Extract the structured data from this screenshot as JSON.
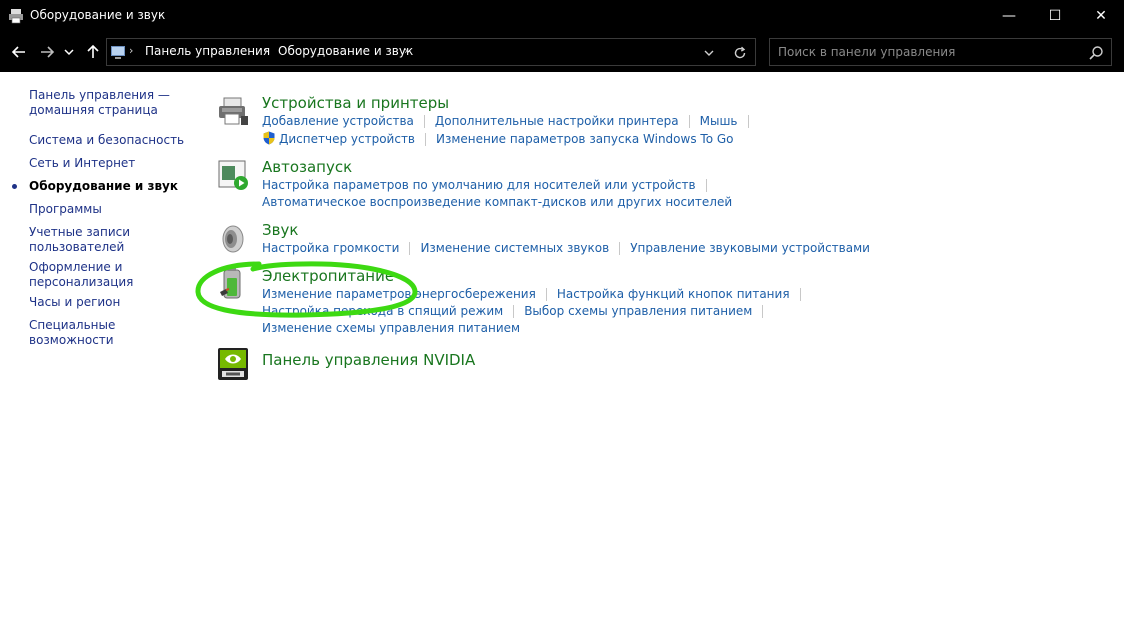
{
  "window": {
    "title": "Оборудование и звук",
    "controls": {
      "minimize": "—",
      "maximize": "☐",
      "close": "✕"
    }
  },
  "nav": {
    "back_icon": "arrow-left-icon",
    "forward_icon": "arrow-right-icon",
    "up_icon": "arrow-up-icon",
    "breadcrumbs": [
      "Панель управления",
      "Оборудование и звук"
    ],
    "breadcrumb_separator": "›",
    "search": {
      "placeholder": "Поиск в панели управления",
      "value": ""
    }
  },
  "sidebar": {
    "items": [
      {
        "label": "Панель управления — домашняя страница",
        "active": false
      },
      {
        "label": "Система и безопасность",
        "active": false
      },
      {
        "label": "Сеть и Интернет",
        "active": false
      },
      {
        "label": "Оборудование и звук",
        "active": true
      },
      {
        "label": "Программы",
        "active": false
      },
      {
        "label": "Учетные записи пользователей",
        "active": false
      },
      {
        "label": "Оформление и персонализация",
        "active": false
      },
      {
        "label": "Часы и регион",
        "active": false
      },
      {
        "label": "Специальные возможности",
        "active": false
      }
    ]
  },
  "categories": [
    {
      "title": "Устройства и принтеры",
      "icon": "printer-icon",
      "link_rows": [
        [
          "Добавление устройства",
          "Дополнительные настройки принтера",
          "Мышь"
        ],
        [
          "Диспетчер устройств",
          "Изменение параметров запуска Windows To Go"
        ]
      ]
    },
    {
      "title": "Автозапуск",
      "icon": "autoplay-icon",
      "link_rows": [
        [
          "Настройка параметров по умолчанию для носителей или устройств"
        ],
        [
          "Автоматическое воспроизведение компакт-дисков или других носителей"
        ]
      ]
    },
    {
      "title": "Звук",
      "icon": "speaker-icon",
      "link_rows": [
        [
          "Настройка громкости",
          "Изменение системных звуков",
          "Управление звуковыми устройствами"
        ]
      ]
    },
    {
      "title": "Электропитание",
      "icon": "battery-icon",
      "link_rows": [
        [
          "Изменение параметров энергосбережения",
          "Настройка функций кнопок питания"
        ],
        [
          "Настройка перехода в спящий режим",
          "Выбор схемы управления питанием"
        ],
        [
          "Изменение схемы управления питанием"
        ]
      ]
    },
    {
      "title": "Панель управления NVIDIA",
      "icon": "nvidia-icon",
      "link_rows": []
    }
  ],
  "colors": {
    "title_bar": "#000000",
    "category_title": "#19761f",
    "link": "#1e5fa8",
    "sidebar_link": "#1e3287",
    "annotation_circle": "#3dd912"
  }
}
